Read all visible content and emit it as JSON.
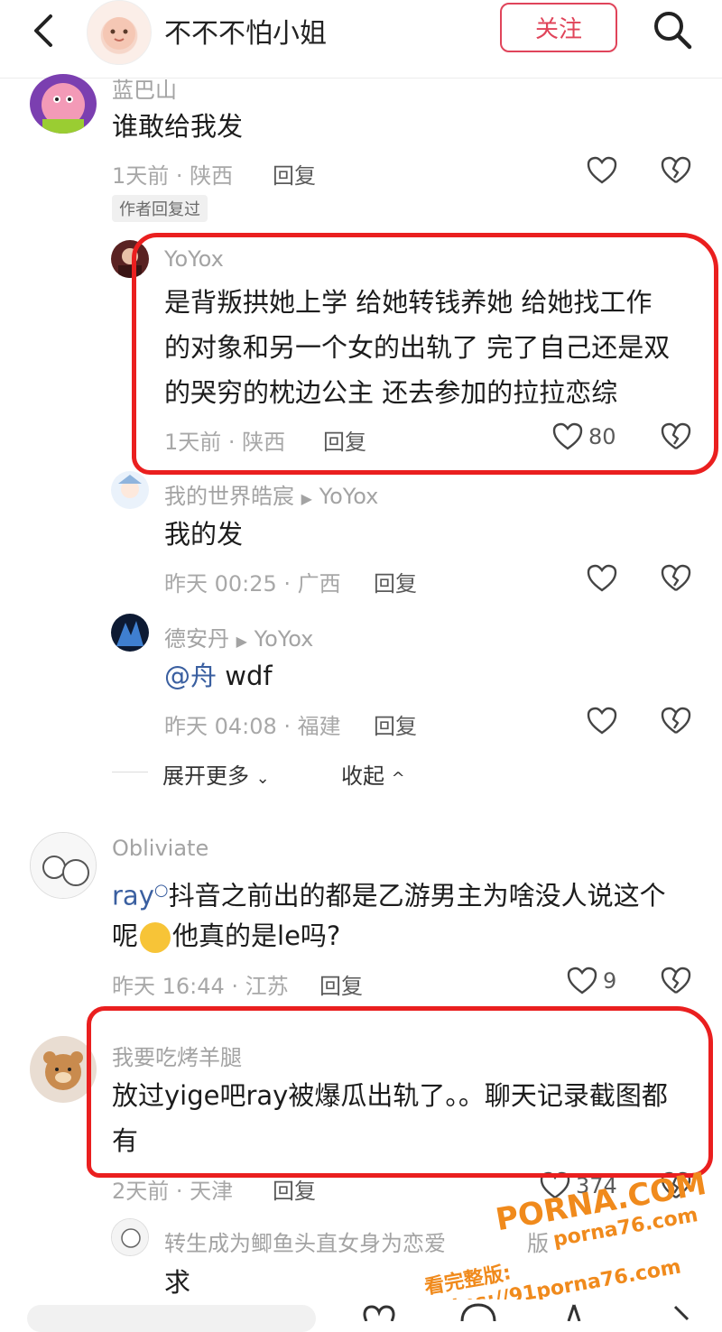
{
  "header": {
    "author_name": "不不不怕小姐",
    "follow_label": "关注"
  },
  "comments": [
    {
      "username": "蓝巴山",
      "text": "谁敢给我发",
      "meta": "1天前 · 陕西",
      "reply": "回复",
      "tag": "作者回复过"
    },
    {
      "username": "YoYox",
      "lines": [
        "是背叛拱她上学 给她转钱养她 给她找工作",
        "的对象和另一个女的出轨了 完了自己还是双",
        "的哭穷的枕边公主 还去参加的拉拉恋综"
      ],
      "meta": "1天前 · 陕西",
      "reply": "回复",
      "likes": "80"
    },
    {
      "username": "我的世界皓宸",
      "reply_to": "YoYox",
      "text": "我的发",
      "meta": "昨天 00:25 · 广西",
      "reply": "回复"
    },
    {
      "username": "德安丹",
      "reply_to": "YoYox",
      "mention": "@舟",
      "text": " wdf",
      "meta": "昨天 04:08 · 福建",
      "reply": "回复"
    },
    {
      "username": "Obliviate",
      "mention": "ray",
      "line1": "抖音之前出的都是乙游男主为啥没人说这个",
      "line2": "呢",
      "line2b": "他真的是le吗?",
      "meta": "昨天 16:44 · 江苏",
      "reply": "回复",
      "likes": "9"
    },
    {
      "username": "我要吃烤羊腿",
      "line1": "放过yige吧ray被爆瓜出轨了。。聊天记录截图都",
      "line2": "有",
      "meta": "2天前 · 天津",
      "reply": "回复",
      "likes": "374"
    },
    {
      "username": "转生成为鲫鱼头直女身为恋爱",
      "username_tail": "版",
      "text": "求"
    }
  ],
  "thread": {
    "expand_label": "展开更多",
    "collapse_label": "收起"
  },
  "watermark": {
    "site": "PORNA.COM",
    "url": "porna76.com",
    "banner": "看完整版: https://91porna76.com"
  },
  "colors": {
    "accent": "#e0445a",
    "annotation_red": "#ea1f1f",
    "watermark_orange": "#f08a1c"
  }
}
